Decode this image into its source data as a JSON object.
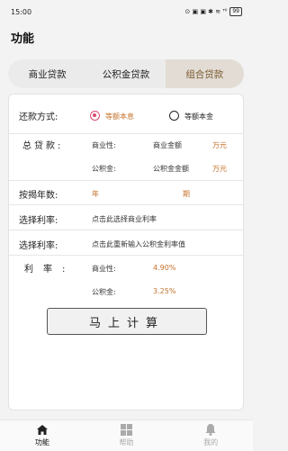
{
  "status": {
    "time": "15:00",
    "icons": "⊙ ▣ ▣ ✱ ≋ ᵀˡˡ",
    "battery": "99"
  },
  "app": {
    "title": "功能"
  },
  "tabs": [
    {
      "label": "商业贷款",
      "active": false
    },
    {
      "label": "公积金贷款",
      "active": false
    },
    {
      "label": "组合贷款",
      "active": true
    }
  ],
  "form": {
    "repayment": {
      "label": "还款方式:",
      "option1": "等额本息",
      "option2": "等额本金",
      "selected": "等额本息"
    },
    "total_loan": {
      "label": "总贷款:",
      "commercial_prefix": "商业性:",
      "commercial_placeholder": "商业金额",
      "fund_prefix": "公积金:",
      "fund_placeholder": "公积金金额",
      "unit": "万元"
    },
    "years": {
      "label": "按揭年数:",
      "unit1": "年",
      "unit2": "期"
    },
    "rate_select1": {
      "label": "选择利率:",
      "hint": "点击此选择商业利率"
    },
    "rate_select2": {
      "label": "选择利率:",
      "hint": "点击此重新输入公积金利率值"
    },
    "rates": {
      "label": "利率:",
      "commercial_prefix": "商业性:",
      "commercial_value": "4.90%",
      "fund_prefix": "公积金:",
      "fund_value": "3.25%"
    },
    "calculate_button": "马上计算"
  },
  "bottom_nav": [
    {
      "label": "功能",
      "icon": "home-icon",
      "active": true
    },
    {
      "label": "帮助",
      "icon": "grid-icon",
      "active": false
    },
    {
      "label": "我的",
      "icon": "bell-icon",
      "active": false
    }
  ]
}
